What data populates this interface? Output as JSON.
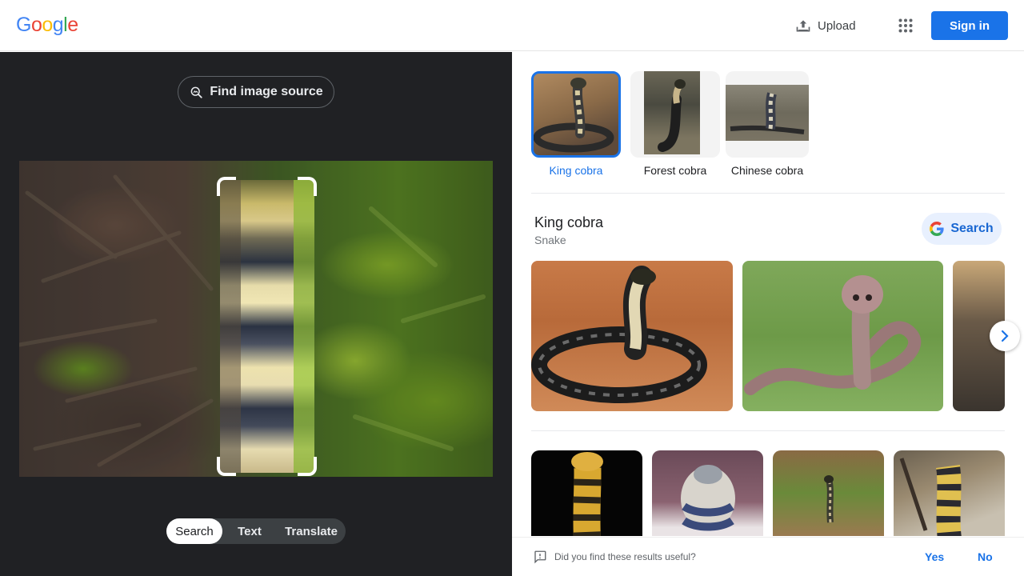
{
  "header": {
    "logo_letters": [
      {
        "ch": "G",
        "color": "#4285F4"
      },
      {
        "ch": "o",
        "color": "#EA4335"
      },
      {
        "ch": "o",
        "color": "#FBBC05"
      },
      {
        "ch": "g",
        "color": "#4285F4"
      },
      {
        "ch": "l",
        "color": "#34A853"
      },
      {
        "ch": "e",
        "color": "#EA4335"
      }
    ],
    "upload_label": "Upload",
    "apps_icon": "apps-grid-icon",
    "signin_label": "Sign in"
  },
  "left_panel": {
    "find_source_label": "Find image source",
    "modes": [
      "Search",
      "Text",
      "Translate"
    ],
    "active_mode": "Search"
  },
  "right_panel": {
    "chips": [
      {
        "label": "King cobra",
        "selected": true
      },
      {
        "label": "Forest cobra",
        "selected": false
      },
      {
        "label": "Chinese cobra",
        "selected": false
      }
    ],
    "entity": {
      "title": "King cobra",
      "subtitle": "Snake",
      "search_label": "Search"
    },
    "feedback": {
      "question": "Did you find these results useful?",
      "yes": "Yes",
      "no": "No"
    }
  },
  "colors": {
    "accent": "#1a73e8",
    "dark_panel": "#202124"
  }
}
